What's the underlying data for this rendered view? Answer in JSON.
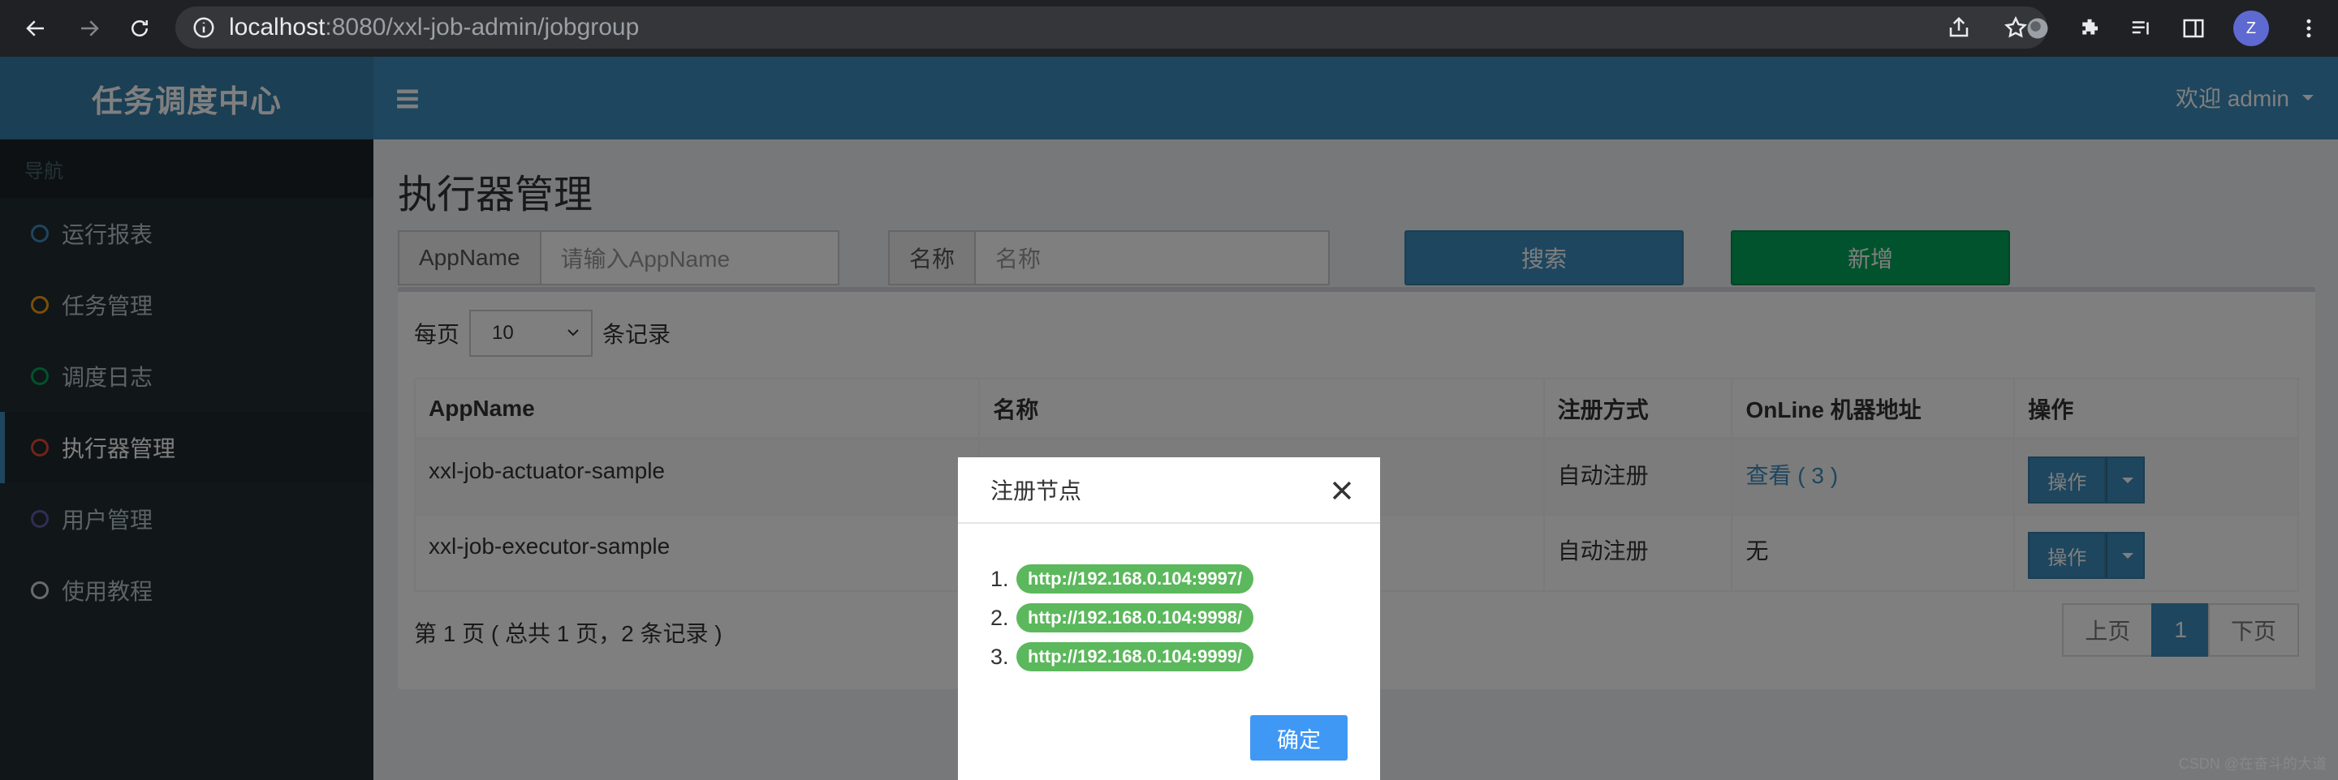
{
  "browser": {
    "url_host": "localhost",
    "url_rest": ":8080/xxl-job-admin/jobgroup",
    "profile_initial": "Z"
  },
  "header": {
    "logo": "任务调度中心",
    "user_greeting": "欢迎 admin"
  },
  "sidebar": {
    "section_label": "导航",
    "items": [
      {
        "label": "运行报表",
        "color": "#3c8dbc"
      },
      {
        "label": "任务管理",
        "color": "#f39c12"
      },
      {
        "label": "调度日志",
        "color": "#00a65a"
      },
      {
        "label": "执行器管理",
        "color": "#dd4b39"
      },
      {
        "label": "用户管理",
        "color": "#605ca8"
      },
      {
        "label": "使用教程",
        "color": "#d2d6de"
      }
    ]
  },
  "main": {
    "title": "执行器管理",
    "search": {
      "appname_label": "AppName",
      "appname_placeholder": "请输入AppName",
      "name_label": "名称",
      "name_placeholder": "名称",
      "search_button": "搜索",
      "add_button": "新增"
    },
    "length": {
      "prefix": "每页",
      "value": "10",
      "suffix": "条记录"
    },
    "table": {
      "headers": [
        "AppName",
        "名称",
        "注册方式",
        "OnLine 机器地址",
        "操作"
      ],
      "rows": [
        {
          "appname": "xxl-job-actuator-sample",
          "name": "",
          "registry": "自动注册",
          "online": "查看 ( 3 )",
          "action": "操作"
        },
        {
          "appname": "xxl-job-executor-sample",
          "name": "",
          "registry": "自动注册",
          "online": "无",
          "action": "操作"
        }
      ]
    },
    "info": "第 1 页 ( 总共 1 页，2 条记录 )",
    "pager": {
      "prev": "上页",
      "current": "1",
      "next": "下页"
    }
  },
  "modal": {
    "title": "注册节点",
    "items": [
      {
        "num": "1.",
        "url": "http://192.168.0.104:9997/"
      },
      {
        "num": "2.",
        "url": "http://192.168.0.104:9998/"
      },
      {
        "num": "3.",
        "url": "http://192.168.0.104:9999/"
      }
    ],
    "ok_button": "确定"
  },
  "watermark": "CSDN @在奋斗的大道"
}
